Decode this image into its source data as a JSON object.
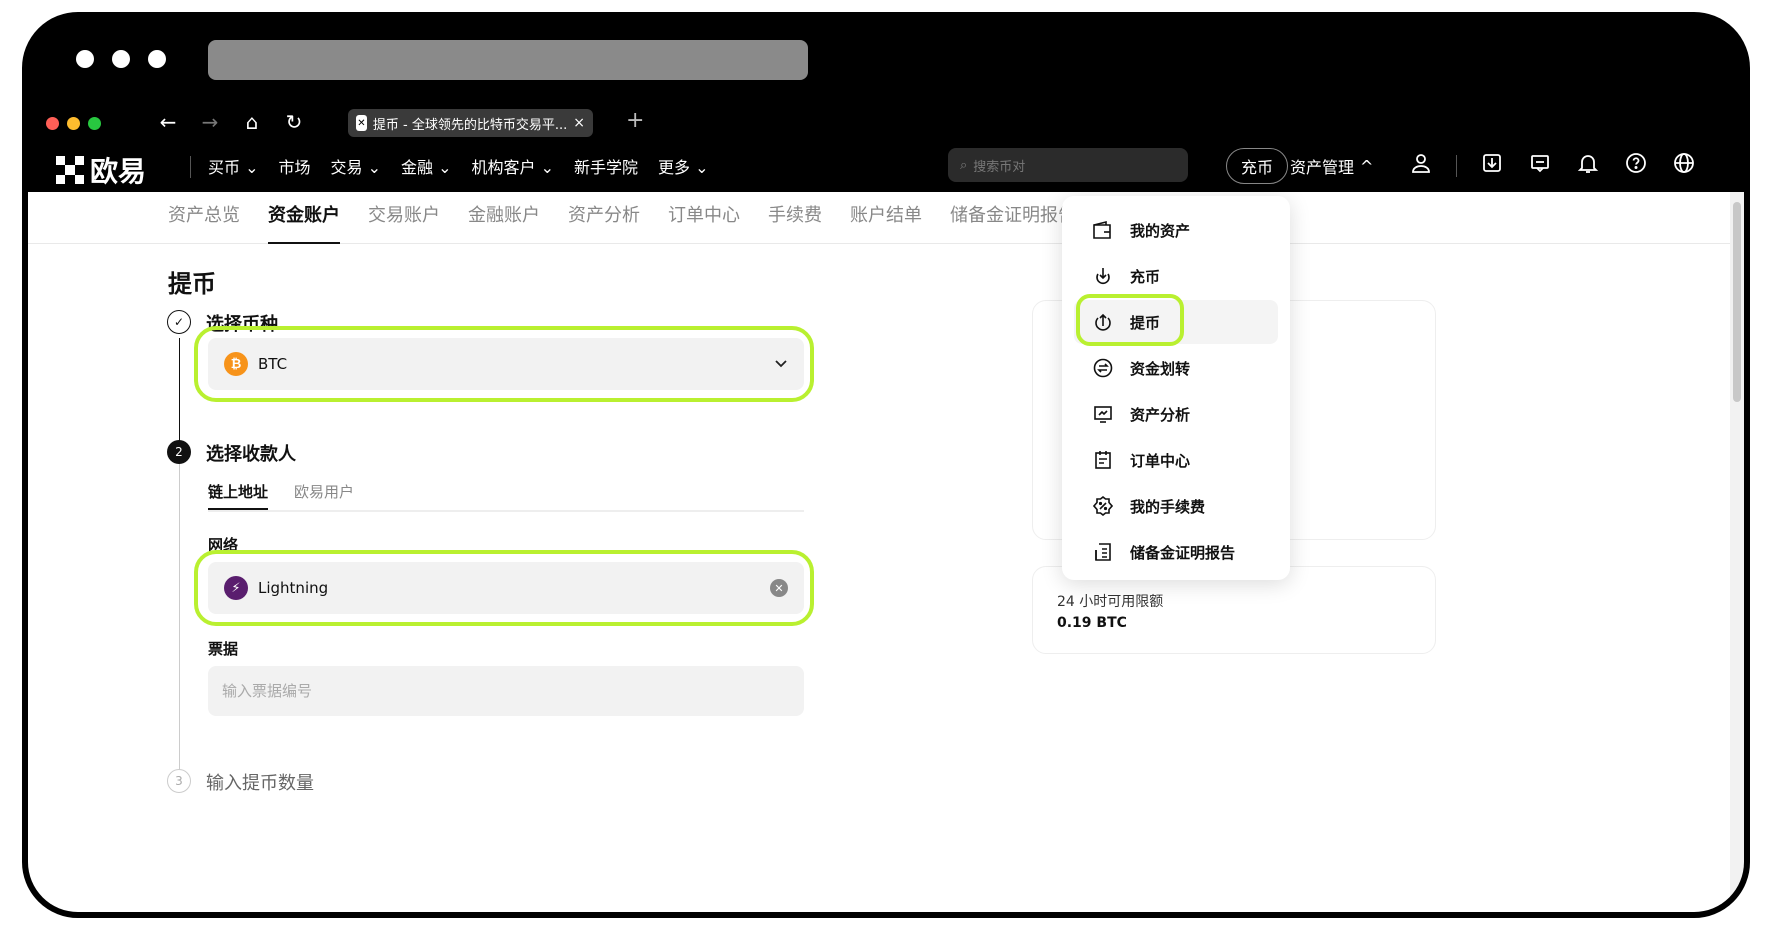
{
  "browser": {
    "tab_title": "提币 - 全球领先的比特币交易平...",
    "tab_close": "×",
    "new_tab": "+",
    "back": "←",
    "forward": "→",
    "home": "⌂",
    "reload": "↻"
  },
  "header": {
    "logo_text": "欧易",
    "menu": [
      "买币 ⌄",
      "市场",
      "交易 ⌄",
      "金融 ⌄",
      "机构客户 ⌄",
      "新手学院",
      "更多 ⌄"
    ],
    "search_placeholder": "搜索币对",
    "deposit_label": "充币",
    "asset_mgmt_label": "资产管理",
    "asset_mgmt_caret": "^"
  },
  "subnav": [
    "资产总览",
    "资金账户",
    "交易账户",
    "金融账户",
    "资产分析",
    "订单中心",
    "手续费",
    "账户结单",
    "储备金证明报告"
  ],
  "page": {
    "title": "提币",
    "step1_label": "选择币种",
    "step1_num": "✓",
    "coin_symbol": "₿",
    "coin": "BTC",
    "step2_num": "2",
    "step2_label": "选择收款人",
    "recipient_tabs": [
      "链上地址",
      "欧易用户"
    ],
    "network_label": "网络",
    "network": "Lightning",
    "network_icon": "⚡",
    "invoice_label": "票据",
    "invoice_placeholder": "输入票据编号",
    "step3_num": "3",
    "step3_label": "输入提币数量"
  },
  "limit_card": {
    "label": "24 小时可用限额",
    "value": "0.19 BTC"
  },
  "dropdown": {
    "items": [
      "我的资产",
      "充币",
      "提币",
      "资金划转",
      "资产分析",
      "订单中心",
      "我的手续费",
      "储备金证明报告"
    ]
  },
  "colors": {
    "highlight": "#b9f030",
    "btc": "#f7931a",
    "lightning": "#5a1e6e"
  }
}
